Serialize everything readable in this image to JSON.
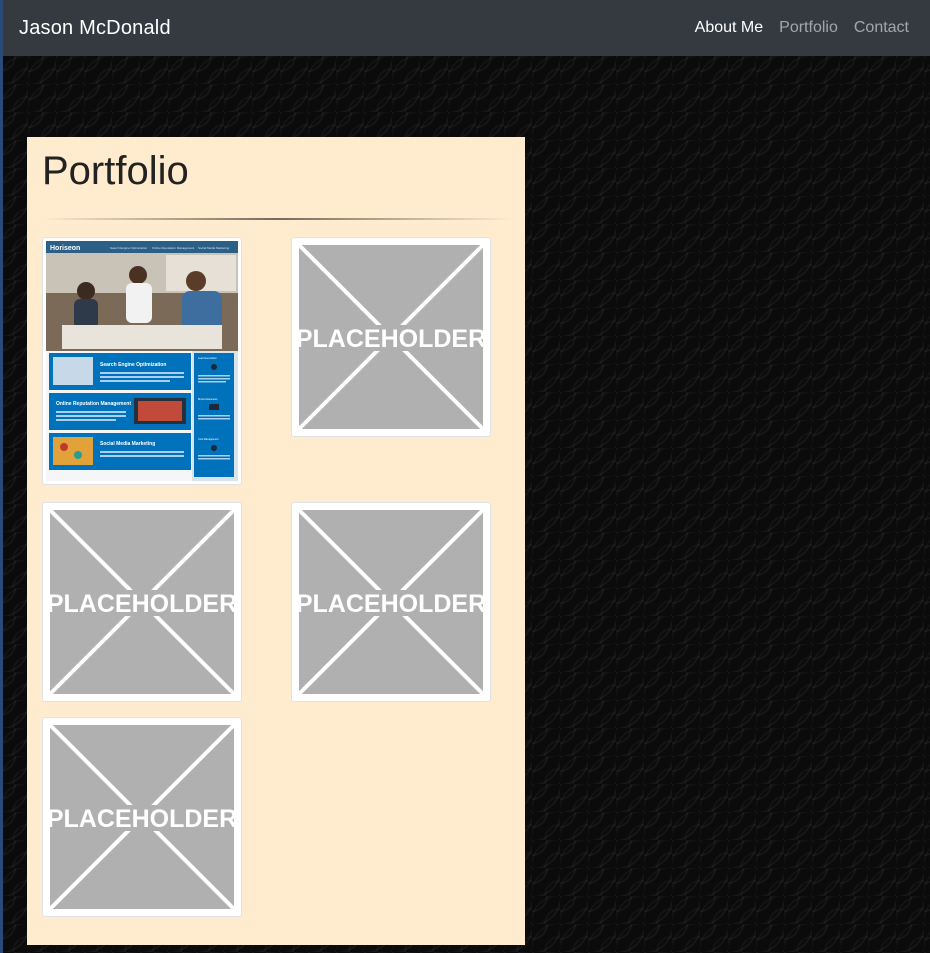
{
  "navbar": {
    "brand": "Jason McDonald",
    "links": [
      {
        "label": "About Me",
        "active": true
      },
      {
        "label": "Portfolio",
        "active": false
      },
      {
        "label": "Contact",
        "active": false
      }
    ]
  },
  "portfolio": {
    "title": "Portfolio",
    "items": [
      {
        "kind": "screenshot",
        "site_name": "Horiseon",
        "nav_links": [
          "Search Engine Optimization",
          "Online Reputation Management",
          "Social Media Marketing"
        ],
        "sections": [
          "Search Engine Optimization",
          "Online Reputation Management",
          "Social Media Marketing"
        ],
        "side_items": [
          "Lead Generation",
          "Brand Awareness",
          "Cost Management"
        ]
      },
      {
        "kind": "placeholder",
        "label": "PLACEHOLDER"
      },
      {
        "kind": "placeholder",
        "label": "PLACEHOLDER"
      },
      {
        "kind": "placeholder",
        "label": "PLACEHOLDER"
      },
      {
        "kind": "placeholder",
        "label": "PLACEHOLDER"
      }
    ]
  },
  "colors": {
    "navbar_bg": "#343a40",
    "card_bg": "#ffebcd",
    "placeholder_gray": "#b0b0b0",
    "horiseon_blue": "#0072bb"
  }
}
